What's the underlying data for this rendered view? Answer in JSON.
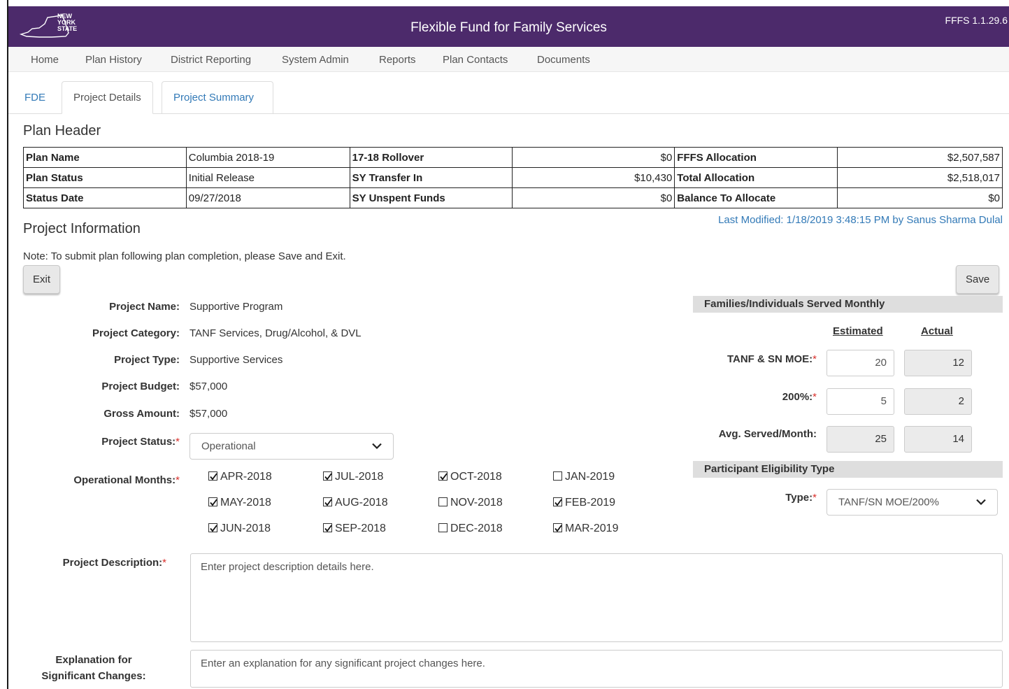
{
  "header": {
    "logo_text": [
      "NEW",
      "YORK",
      "STATE"
    ],
    "title": "Flexible Fund for Family Services",
    "version": "FFFS 1.1.29.6",
    "bg_color": "#4c2a6b"
  },
  "nav": {
    "items": [
      "Home",
      "Plan History",
      "District Reporting",
      "System Admin",
      "Reports",
      "Plan Contacts",
      "Documents"
    ]
  },
  "tabs": {
    "items": [
      "FDE",
      "Project Details",
      "Project Summary"
    ],
    "active": "Project Details"
  },
  "plan_header": {
    "title": "Plan Header",
    "rows": [
      [
        "Plan Name",
        "Columbia 2018-19",
        "17-18 Rollover",
        "$0",
        "FFFS Allocation",
        "$2,507,587"
      ],
      [
        "Plan Status",
        "Initial Release",
        "SY Transfer In",
        "$10,430",
        "Total Allocation",
        "$2,518,017"
      ],
      [
        "Status Date",
        "09/27/2018",
        "SY Unspent Funds",
        "$0",
        "Balance To Allocate",
        "$0"
      ]
    ]
  },
  "project_info": {
    "title": "Project Information",
    "last_modified": "Last Modified: 1/18/2019 3:48:15 PM by Sanus Sharma Dulal",
    "note": "Note: To submit plan following plan completion, please Save and Exit.",
    "exit_label": "Exit",
    "save_label": "Save",
    "required_mark": "*"
  },
  "fields": {
    "project_name_label": "Project Name:",
    "project_name": "Supportive Program",
    "project_category_label": "Project Category:",
    "project_category": "TANF Services, Drug/Alcohol, & DVL",
    "project_type_label": "Project Type:",
    "project_type": "Supportive Services",
    "project_budget_label": "Project Budget:",
    "project_budget": "$57,000",
    "gross_amount_label": "Gross Amount:",
    "gross_amount": "$57,000",
    "project_status_label": "Project Status:",
    "project_status": "Operational",
    "operational_months_label": "Operational Months:",
    "description_label": "Project Description:",
    "description_placeholder": "Enter project description details here.",
    "explanation_label_1": "Explanation for",
    "explanation_label_2": "Significant Changes:",
    "explanation_placeholder": "Enter an explanation for any significant project changes here."
  },
  "months": [
    [
      {
        "label": "APR-2018",
        "checked": true
      },
      {
        "label": "JUL-2018",
        "checked": true
      },
      {
        "label": "OCT-2018",
        "checked": true
      },
      {
        "label": "JAN-2019",
        "checked": false
      }
    ],
    [
      {
        "label": "MAY-2018",
        "checked": true
      },
      {
        "label": "AUG-2018",
        "checked": true
      },
      {
        "label": "NOV-2018",
        "checked": false
      },
      {
        "label": "FEB-2019",
        "checked": true
      }
    ],
    [
      {
        "label": "JUN-2018",
        "checked": true
      },
      {
        "label": "SEP-2018",
        "checked": true
      },
      {
        "label": "DEC-2018",
        "checked": false
      },
      {
        "label": "MAR-2019",
        "checked": true
      }
    ]
  ],
  "served": {
    "title": "Families/Individuals Served Monthly",
    "estimated_header": "Estimated",
    "actual_header": "Actual",
    "rows": [
      {
        "label": "TANF & SN MOE:",
        "required": true,
        "estimated": "20",
        "actual": "12"
      },
      {
        "label": "200%:",
        "required": true,
        "estimated": "5",
        "actual": "2"
      },
      {
        "label": "Avg. Served/Month:",
        "required": false,
        "estimated": "25",
        "actual": "14"
      }
    ]
  },
  "eligibility": {
    "title": "Participant Eligibility Type",
    "type_label": "Type:",
    "type_value": "TANF/SN MOE/200%"
  }
}
